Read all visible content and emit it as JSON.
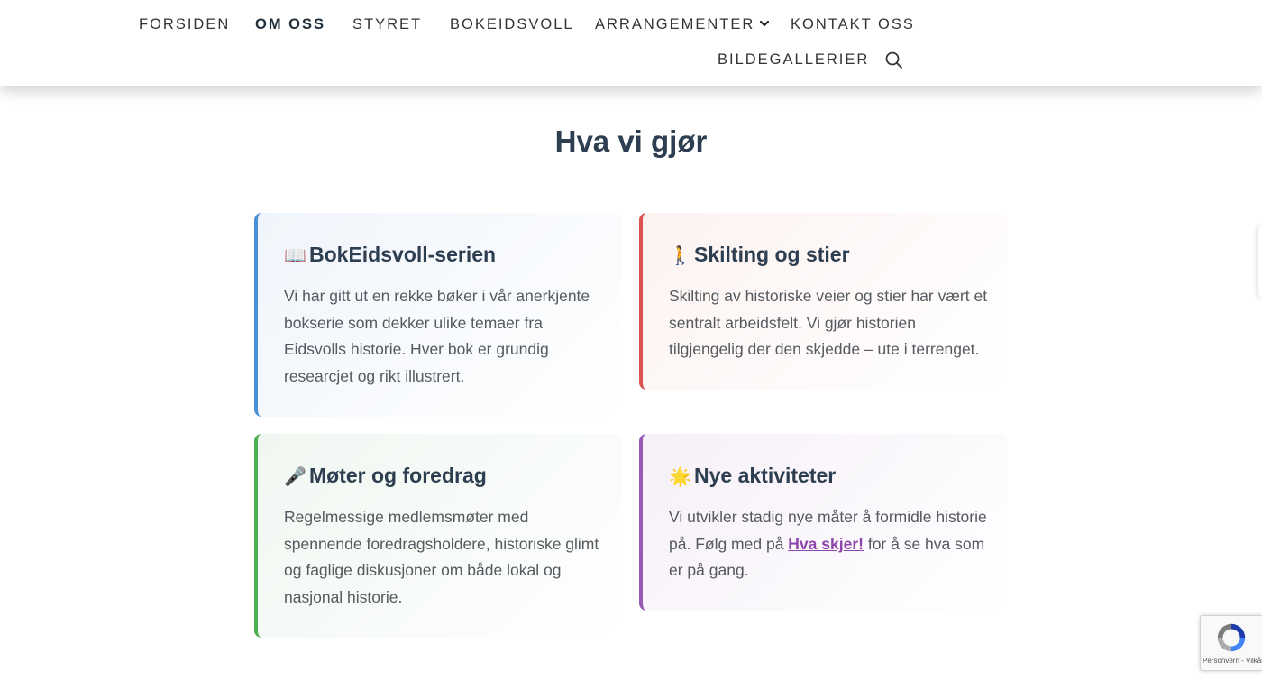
{
  "nav": {
    "items": [
      {
        "label": "FORSIDEN"
      },
      {
        "label": "OM OSS",
        "active": true
      },
      {
        "label": "STYRET"
      },
      {
        "label": "BOKEIDSVOLL"
      },
      {
        "label": "ARRANGEMENTER",
        "has_dropdown": true
      },
      {
        "label": "KONTAKT OSS"
      },
      {
        "label": "BILDEGALLERIER"
      }
    ],
    "search_icon": "search-icon",
    "dropdown_icon": "chevron-down-icon"
  },
  "section": {
    "title": "Hva vi gjør"
  },
  "cards": [
    {
      "emoji": "📖",
      "title": "BokEidsvoll-serien",
      "text": "Vi har gitt ut en rekke bøker i vår anerkjente bokserie som dekker ulike temaer fra Eidsvolls historie. Hver bok er grundig researcjet og rikt illustrert.",
      "accent": "#4a90d9"
    },
    {
      "emoji": "🚶",
      "title": "Skilting og stier",
      "text": "Skilting av historiske veier og stier har vært et sentralt arbeidsfelt. Vi gjør historien tilgjengelig der den skjedde – ute i terrenget.",
      "accent": "#d9534f"
    },
    {
      "emoji": "🎤",
      "title": "Møter og foredrag",
      "text": "Regelmessige medlemsmøter med spennende foredragsholdere, historiske glimt og faglige diskusjoner om både lokal og nasjonal historie.",
      "accent": "#4caf50"
    },
    {
      "emoji": "🌟",
      "title": "Nye aktiviteter",
      "text_before": "Vi utvikler stadig nye måter å formidle historie på. Følg med på ",
      "link": "Hva skjer!",
      "text_after": " for å se hva som er på gang.",
      "accent": "#9b59b6"
    }
  ],
  "recaptcha": {
    "label": "Personvern - Vilkår",
    "icon": "recaptcha-icon"
  },
  "colors": {
    "heading": "#2c3e50",
    "body_text": "#555a60",
    "link": "#8e44ad"
  }
}
